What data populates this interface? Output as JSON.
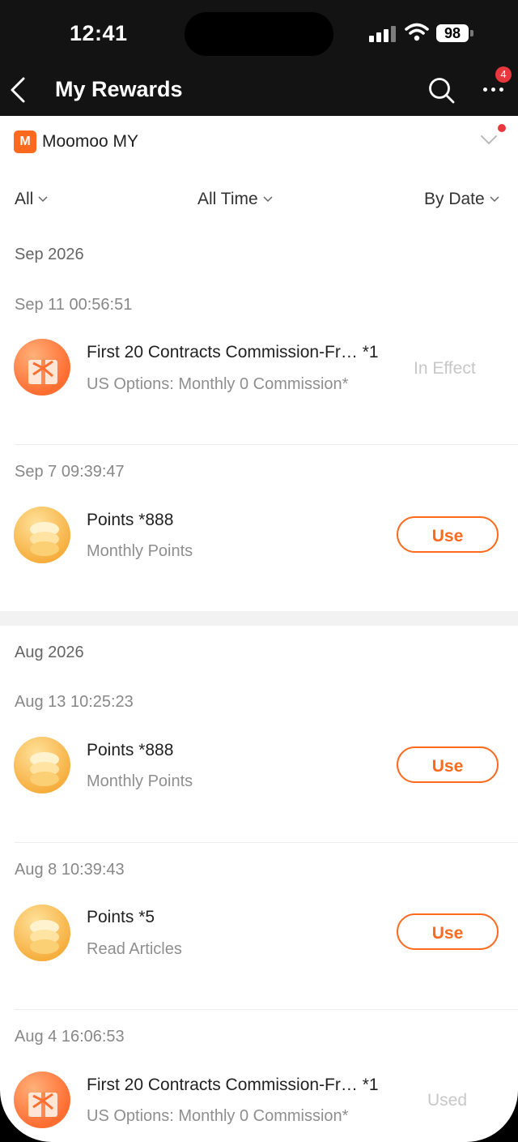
{
  "status_bar": {
    "time": "12:41",
    "battery": "98"
  },
  "header": {
    "title": "My Rewards",
    "badge_count": "4"
  },
  "account": {
    "logo_text": "M",
    "name": "Moomoo MY"
  },
  "filters": {
    "type": "All",
    "time": "All Time",
    "sort": "By Date"
  },
  "colors": {
    "accent": "#ff6a1f",
    "header_bg": "#131313",
    "badge": "#e8383d"
  },
  "sections": [
    {
      "month": "Sep 2026",
      "rewards": [
        {
          "timestamp": "Sep 11 00:56:51",
          "icon": "gift-icon",
          "title": "First 20 Contracts Commission-Fr… *1",
          "subtitle": "US Options: Monthly 0 Commission*",
          "status": "In Effect"
        },
        {
          "timestamp": "Sep 7 09:39:47",
          "icon": "coins-icon",
          "title": "Points *888",
          "subtitle": "Monthly Points",
          "action": "Use"
        }
      ]
    },
    {
      "month": "Aug 2026",
      "rewards": [
        {
          "timestamp": "Aug 13 10:25:23",
          "icon": "coins-icon",
          "title": "Points *888",
          "subtitle": "Monthly Points",
          "action": "Use"
        },
        {
          "timestamp": "Aug 8 10:39:43",
          "icon": "coins-icon",
          "title": "Points *5",
          "subtitle": "Read Articles",
          "action": "Use"
        },
        {
          "timestamp": "Aug 4 16:06:53",
          "icon": "gift-icon",
          "title": "First 20 Contracts Commission-Fr… *1",
          "subtitle": "US Options: Monthly 0 Commission*",
          "status": "Used"
        }
      ]
    }
  ]
}
